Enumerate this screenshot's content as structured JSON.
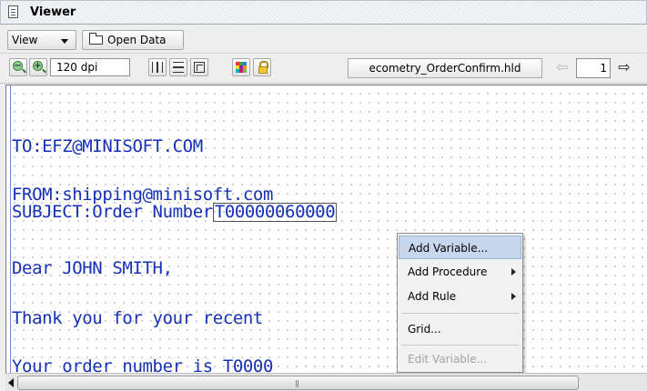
{
  "window": {
    "title": "Viewer"
  },
  "toolbar": {
    "view_label": "View",
    "open_data_label": "Open Data",
    "dpi_value": "120 dpi",
    "file_name": "ecometry_OrderConfirm.hld",
    "page_number": "1"
  },
  "icons": {
    "zoom_out": "zoom-out-icon",
    "zoom_in": "zoom-in-icon",
    "horizontal_separator": "horizontal-separator-icon",
    "vertical_separator": "vertical-separator-icon",
    "fit": "fit-icon",
    "color_grid": "color-grid-icon",
    "lock": "lock-icon",
    "prev_page": "arrow-left-icon",
    "next_page": "arrow-right-icon"
  },
  "colors": {
    "document_text": "#1530b8",
    "menu_highlight": "#c6d6ec",
    "dot_grid": "#a9a9a9"
  },
  "document": {
    "line_to": "TO:EFZ@MINISOFT.COM",
    "line_from": "FROM:shipping@minisoft.com",
    "line_subject_prefix": "SUBJECT:Order Number",
    "line_subject_variable": "T00000060000",
    "line_dear": "Dear JOHN SMITH,",
    "line_thanks": "Thank you for your recent ",
    "line_order": "Your order number is T0000"
  },
  "context_menu": {
    "add_variable": "Add Variable...",
    "add_procedure": "Add Procedure",
    "add_rule": "Add Rule",
    "grid": "Grid...",
    "edit_variable": "Edit Variable..."
  }
}
